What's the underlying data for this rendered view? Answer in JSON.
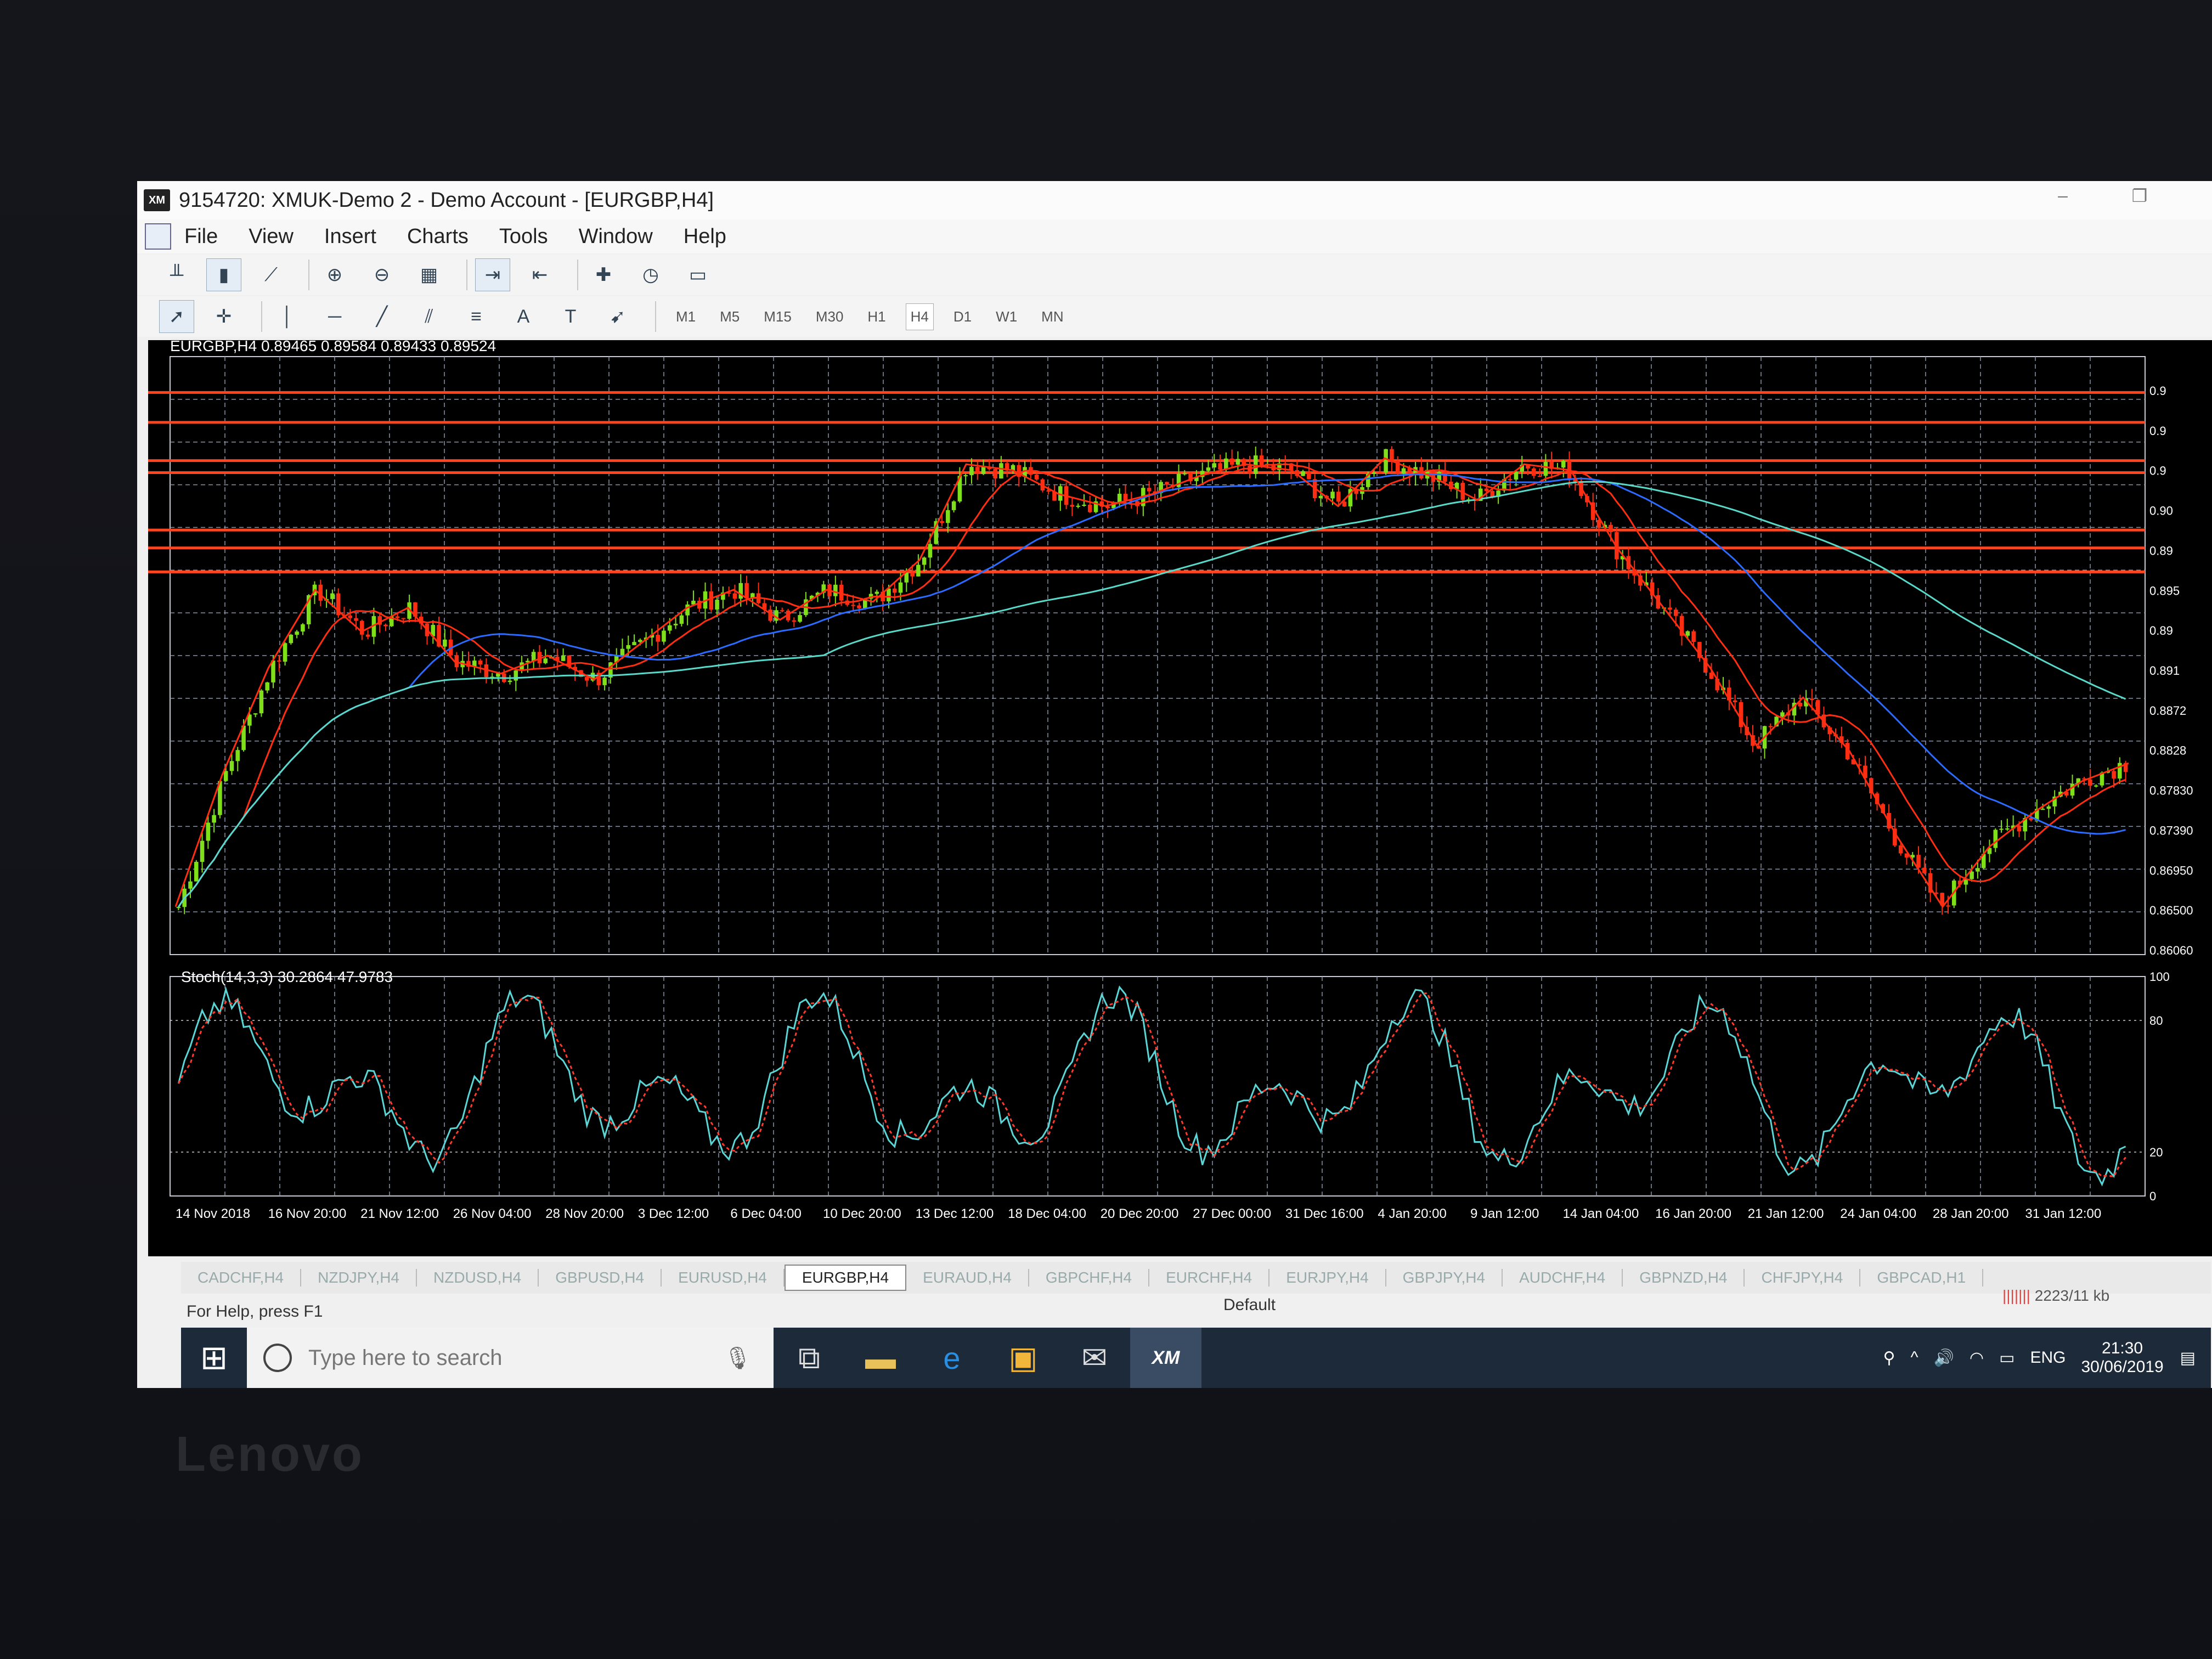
{
  "window": {
    "app_icon": "XM",
    "title": "9154720: XMUK-Demo 2 - Demo Account - [EURGBP,H4]",
    "minimize_icon": "minimize-icon",
    "restore_icon": "restore-icon"
  },
  "menu": [
    "File",
    "View",
    "Insert",
    "Charts",
    "Tools",
    "Window",
    "Help"
  ],
  "toolbar": {
    "icons": [
      "bar-chart-icon",
      "candlestick-icon",
      "line-chart-icon",
      "zoom-in-icon",
      "zoom-out-icon",
      "tile-windows-icon",
      "auto-scroll-icon",
      "chart-shift-icon",
      "indicators-icon",
      "periods-icon",
      "templates-icon"
    ],
    "draw_icons": [
      "cursor-icon",
      "crosshair-icon",
      "vertical-line-icon",
      "horizontal-line-icon",
      "trendline-icon",
      "equidistant-channel-icon",
      "fibonacci-icon",
      "text-icon",
      "text-label-icon",
      "arrows-icon"
    ],
    "draw_text": {
      "text": "A",
      "label": "T"
    },
    "timeframes": [
      "M1",
      "M5",
      "M15",
      "M30",
      "H1",
      "H4",
      "D1",
      "W1",
      "MN"
    ],
    "active_timeframe": "H4"
  },
  "chart": {
    "symbol_info": "EURGBP,H4  0.89465 0.89584 0.89433 0.89524",
    "indicator_info": "Stoch(14,3,3) 30.2864 47.9783",
    "price_labels": [
      "0.9",
      "0.9",
      "0.9",
      "0.90",
      "0.89",
      "0.895",
      "0.89",
      "0.891",
      "0.8872",
      "0.8828",
      "0.87830",
      "0.87390",
      "0.86950",
      "0.86500",
      "0.86060"
    ],
    "stoch_levels": [
      "100",
      "80",
      "20",
      "0"
    ],
    "time_labels": [
      "14 Nov 2018",
      "16 Nov 20:00",
      "21 Nov 12:00",
      "26 Nov 04:00",
      "28 Nov 20:00",
      "3 Dec 12:00",
      "6 Dec 04:00",
      "10 Dec 20:00",
      "13 Dec 12:00",
      "18 Dec 04:00",
      "20 Dec 20:00",
      "27 Dec 00:00",
      "31 Dec 16:00",
      "4 Jan 20:00",
      "9 Jan 12:00",
      "14 Jan 04:00",
      "16 Jan 20:00",
      "21 Jan 12:00",
      "24 Jan 04:00",
      "28 Jan 20:00",
      "31 Jan 12:00"
    ],
    "colors": {
      "bull": "#7fe01a",
      "bear": "#ff2e12",
      "hline": "#ff4520",
      "ma_blue": "#2c6bff",
      "ma_cyan": "#59d9c9",
      "stoch_main": "#5ad6d6",
      "stoch_signal": "#ff3a2a",
      "grid": "#8a94a8"
    }
  },
  "chart_data": {
    "type": "candlestick",
    "symbol": "EURGBP",
    "timeframe": "H4",
    "close_path": [
      0.864,
      0.875,
      0.884,
      0.8905,
      0.887,
      0.889,
      0.8845,
      0.8835,
      0.885,
      0.883,
      0.886,
      0.889,
      0.8905,
      0.888,
      0.8905,
      0.8895,
      0.893,
      0.901,
      0.9005,
      0.8985,
      0.8975,
      0.8985,
      0.9,
      0.901,
      0.9005,
      0.8975,
      0.9015,
      0.9,
      0.898,
      0.901,
      0.9005,
      0.894,
      0.889,
      0.884,
      0.8775,
      0.8815,
      0.877,
      0.87,
      0.864,
      0.869,
      0.872,
      0.8745,
      0.876
    ],
    "horizontal_levels": [
      0.907,
      0.9045,
      0.9013,
      0.9003,
      0.8955,
      0.894,
      0.892
    ],
    "stochastic": {
      "main_last": 30.2864,
      "signal_last": 47.9783,
      "levels": [
        20,
        80
      ]
    }
  },
  "tabs": [
    "CADCHF,H4",
    "NZDJPY,H4",
    "NZDUSD,H4",
    "GBPUSD,H4",
    "EURUSD,H4",
    "EURGBP,H4",
    "EURAUD,H4",
    "GBPCHF,H4",
    "EURCHF,H4",
    "EURJPY,H4",
    "GBPJPY,H4",
    "AUDCHF,H4",
    "GBPNZD,H4",
    "CHFJPY,H4",
    "GBPCAD,H1"
  ],
  "active_tab": "EURGBP,H4",
  "status": {
    "help": "For Help, press F1",
    "profile": "Default",
    "connection": "2223/11 kb",
    "connection_bars": "|||||||"
  },
  "taskbar": {
    "search_placeholder": "Type here to search",
    "language": "ENG",
    "time": "21:30",
    "date": "30/06/2019",
    "app_icons": [
      "task-view-icon",
      "file-explorer-icon",
      "edge-icon",
      "store-icon",
      "mail-icon",
      "xm-icon"
    ],
    "xm_label": "XM"
  },
  "bezel": {
    "brand": "Lenovo"
  }
}
